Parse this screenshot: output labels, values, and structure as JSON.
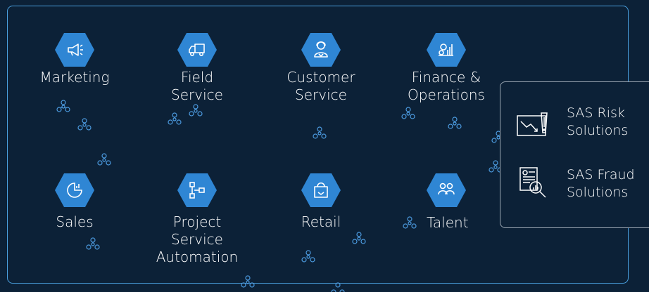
{
  "modules": [
    {
      "label": "Marketing",
      "icon": "megaphone-icon"
    },
    {
      "label": "Field\nService",
      "icon": "truck-icon"
    },
    {
      "label": "Customer\nService",
      "icon": "agent-icon"
    },
    {
      "label": "Finance &\nOperations",
      "icon": "finance-icon"
    },
    {
      "label": "Sales",
      "icon": "sales-chart-icon"
    },
    {
      "label": "Project\nService\nAutomation",
      "icon": "project-flow-icon"
    },
    {
      "label": "Retail",
      "icon": "shopping-bag-icon"
    },
    {
      "label": "Talent",
      "icon": "people-icon"
    }
  ],
  "sas": {
    "items": [
      {
        "label": "SAS Risk\nSolutions",
        "icon": "risk-monitor-icon"
      },
      {
        "label": "SAS Fraud\nSolutions",
        "icon": "fraud-report-icon"
      }
    ]
  },
  "colors": {
    "background": "#0c2137",
    "hex": "#2f86d4",
    "border": "#4aa1e0",
    "molecule": "#4c9be0"
  }
}
